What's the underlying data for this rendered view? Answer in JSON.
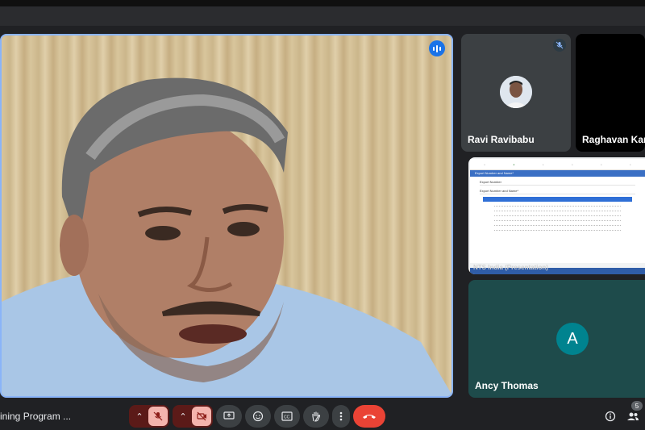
{
  "window": {
    "title": ""
  },
  "main_tile": {
    "speaker_name": "",
    "speaking_indicator": "speaking-icon"
  },
  "participants": [
    {
      "name": "Ravi Ravibabu",
      "muted": true
    },
    {
      "name": "Raghavan Karighat"
    },
    {
      "name": "Ancy Thomas",
      "avatar_letter": "A"
    }
  ],
  "presentation": {
    "label": "NTS India (Presentation)",
    "doc_header": "Export Number and Name*",
    "field_1": "Export Number",
    "field_2": "Export Number and Name*"
  },
  "bottom_bar": {
    "meeting_title": "ining Program ...",
    "people_count": "5"
  },
  "colors": {
    "accent": "#8ab4f8",
    "hangup": "#ea4335",
    "avatar_ancy": "#00838f",
    "background": "#202124"
  }
}
